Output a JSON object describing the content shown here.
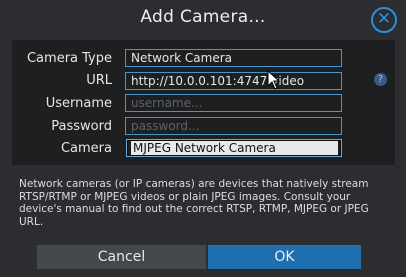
{
  "dialog": {
    "title": "Add Camera..."
  },
  "form": {
    "camera_type": {
      "label": "Camera Type",
      "value": "Network Camera"
    },
    "url": {
      "label": "URL",
      "value": "http://10.0.0.101:4747/video"
    },
    "username": {
      "label": "Username",
      "placeholder": "username..."
    },
    "password": {
      "label": "Password",
      "placeholder": "password..."
    },
    "camera": {
      "label": "Camera",
      "value": "MJPEG Network Camera"
    }
  },
  "help_icon": {
    "glyph": "?"
  },
  "description": "Network cameras (or IP cameras) are devices that natively stream RTSP/RTMP or MJPEG videos or plain JPEG images. Consult your device's manual to find out the correct RTSP, RTMP, MJPEG or JPEG URL.",
  "buttons": {
    "cancel": "Cancel",
    "ok": "OK"
  },
  "colors": {
    "accent": "#2a8fdc",
    "ok_button": "#1f6fae",
    "panel": "#1d1f21",
    "background": "#2b2d30"
  }
}
